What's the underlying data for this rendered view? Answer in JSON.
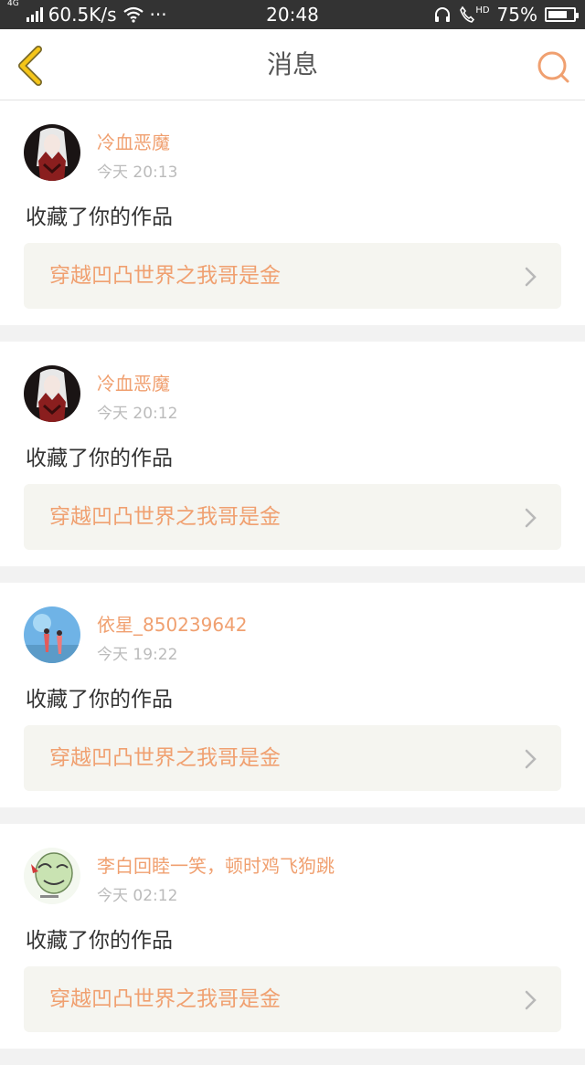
{
  "status_bar": {
    "network_type": "4G",
    "speed": "60.5K/s",
    "more": "···",
    "time": "20:48",
    "hd": "HD",
    "battery_percent": "75%",
    "battery_level": 0.75
  },
  "nav": {
    "title": "消息",
    "back_icon": "chevron-left-icon",
    "search_icon": "search-icon",
    "accent_color": "#f0a070",
    "back_color": "#f5c518"
  },
  "messages": [
    {
      "username": "冷血恶魔",
      "time": "今天 20:13",
      "action": "收藏了你的作品",
      "work_title": "穿越凹凸世界之我哥是金"
    },
    {
      "username": "冷血恶魔",
      "time": "今天 20:12",
      "action": "收藏了你的作品",
      "work_title": "穿越凹凸世界之我哥是金"
    },
    {
      "username": "依星_850239642",
      "time": "今天 19:22",
      "action": "收藏了你的作品",
      "work_title": "穿越凹凸世界之我哥是金"
    },
    {
      "username": "李白回睦一笑，顿时鸡飞狗跳",
      "time": "今天 02:12",
      "action": "收藏了你的作品",
      "work_title": "穿越凹凸世界之我哥是金"
    }
  ]
}
